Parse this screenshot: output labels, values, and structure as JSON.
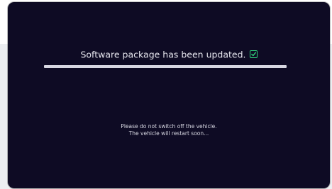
{
  "update_screen": {
    "status_message": "Software package has been updated.",
    "status_icon": "checkbox-checked-icon",
    "progress": 1.0,
    "notice_line_1": "Please do not switch off the vehicle.",
    "notice_line_2": "The vehicle will restart soon..."
  },
  "colors": {
    "panel_background": "#0e0b24",
    "check_accent": "#2fd07a",
    "progress_fill": "#d7d7e2"
  }
}
